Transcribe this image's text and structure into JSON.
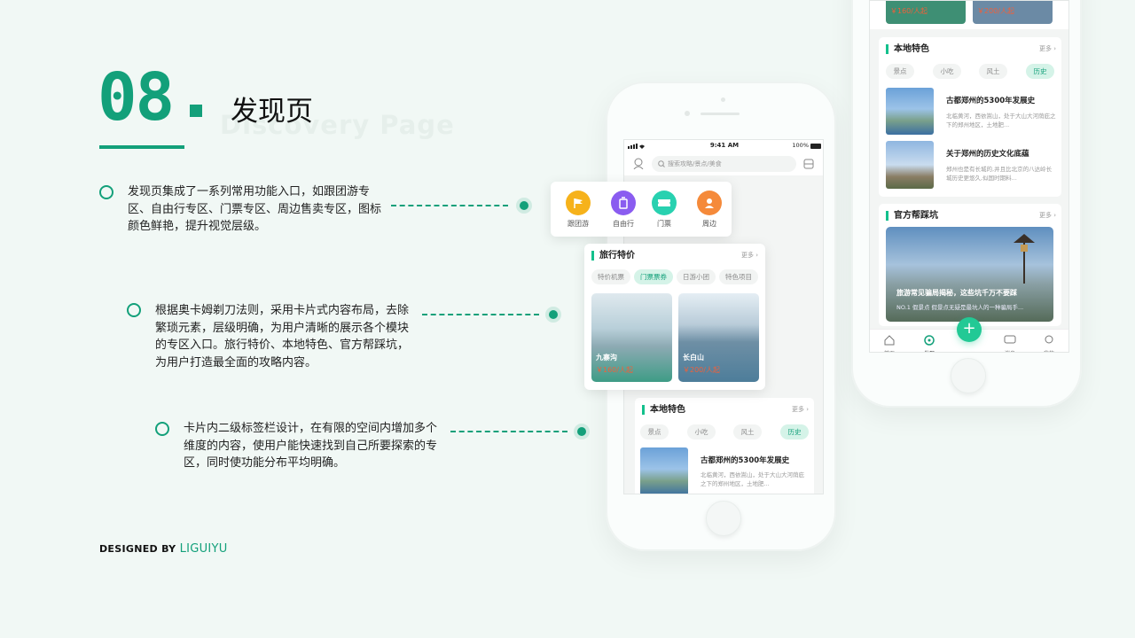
{
  "header": {
    "number": "08",
    "title": "发现页",
    "subtitle_watermark": "Discovery Page"
  },
  "points": [
    {
      "text": "发现页集成了一系列常用功能入口，如跟团游专区、自由行专区、门票专区、周边售卖专区，图标颜色鲜艳，提升视觉层级。"
    },
    {
      "text": "根据奥卡姆剃刀法则，采用卡片式内容布局，去除繁琐元素，层级明确，为用户清晰的展示各个模块的专区入口。旅行特价、本地特色、官方帮踩坑，为用户打造最全面的攻略内容。"
    },
    {
      "text": "卡片内二级标签栏设计，在有限的空间内增加多个维度的内容，使用户能快速找到自己所要探索的专区，同时使功能分布平均明确。"
    }
  ],
  "footer": {
    "designed_by": "DESIGNED BY",
    "designer": "LIGUIYU"
  },
  "status_bar": {
    "time": "9:41 AM",
    "battery": "100%"
  },
  "search": {
    "placeholder": "搜索攻略/景点/美食"
  },
  "entries": [
    {
      "label": "跟团游",
      "icon": "flag-icon",
      "color": "#f6b21b"
    },
    {
      "label": "自由行",
      "icon": "suitcase-icon",
      "color": "#8a5cf0"
    },
    {
      "label": "门票",
      "icon": "ticket-icon",
      "color": "#28d1b0"
    },
    {
      "label": "周边",
      "icon": "person-icon",
      "color": "#f58a3a"
    }
  ],
  "travel_deals": {
    "title": "旅行特价",
    "more": "更多",
    "tabs": [
      "特价机票",
      "门票票券",
      "日游小团",
      "特色项目"
    ],
    "active_tab": "门票票券",
    "items": [
      {
        "name": "九寨沟",
        "price": "￥160/人起"
      },
      {
        "name": "长白山",
        "price": "￥200/人起"
      }
    ]
  },
  "local_features": {
    "title": "本地特色",
    "more": "更多",
    "tabs": [
      "景点",
      "小吃",
      "风土",
      "历史"
    ],
    "active_tab": "历史",
    "articles": [
      {
        "title": "古都郑州的5300年发展史",
        "desc": "北临黄河，西依嵩山，处于大山大河荫庇之下的郑州地区，土地肥..."
      },
      {
        "title": "关于郑州的历史文化底蕴",
        "desc": "郑州也是有长城的,并且比北京的八达岭长城历史更悠久,似国时期料..."
      }
    ]
  },
  "pitfalls": {
    "title": "官方帮踩坑",
    "more": "更多",
    "headline": "旅游常见骗局揭秘，这些坑千万不要踩",
    "desc": "NO.1 假景点 假景点无疑是最坑人的一种骗局手..."
  },
  "right_top_prices": [
    "￥160/人起",
    "￥200/人起"
  ],
  "tabbar": [
    {
      "label": "首页",
      "icon": "home-icon"
    },
    {
      "label": "发现",
      "icon": "discover-icon"
    },
    {
      "label": "消息",
      "icon": "message-icon"
    },
    {
      "label": "我的",
      "icon": "profile-icon"
    }
  ],
  "colors": {
    "accent": "#13a07a",
    "price": "#f0603a"
  }
}
